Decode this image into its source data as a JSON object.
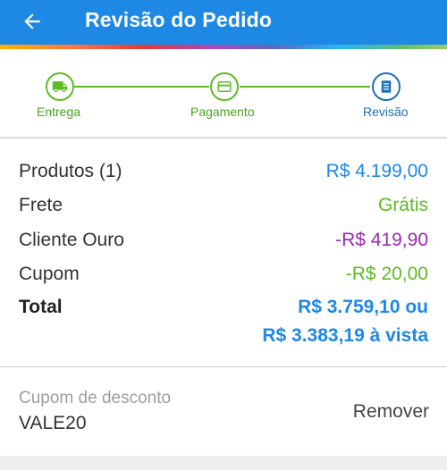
{
  "header": {
    "title": "Revisão do Pedido",
    "back_icon": "arrow-left-icon"
  },
  "colors": {
    "primary": "#1e88e5",
    "step_green": "#5dbb23",
    "gold_purple": "#9c27b0",
    "free_green": "#5dbb23"
  },
  "steps": [
    {
      "label": "Entrega",
      "icon": "truck-icon",
      "state": "done"
    },
    {
      "label": "Pagamento",
      "icon": "card-icon",
      "state": "done"
    },
    {
      "label": "Revisão",
      "icon": "document-icon",
      "state": "active"
    }
  ],
  "summary": {
    "products_label": "Produtos (1)",
    "products_value": "R$ 4.199,00",
    "shipping_label": "Frete",
    "shipping_value": "Grátis",
    "gold_label": "Cliente Ouro",
    "gold_value": "-R$ 419,90",
    "coupon_label": "Cupom",
    "coupon_value": "-R$ 20,00",
    "total_label": "Total",
    "total_line1": "R$ 3.759,10 ou",
    "total_line2": "R$ 3.383,19 à vista"
  },
  "coupon": {
    "caption": "Cupom de desconto",
    "code": "VALE20",
    "remove_label": "Remover"
  }
}
